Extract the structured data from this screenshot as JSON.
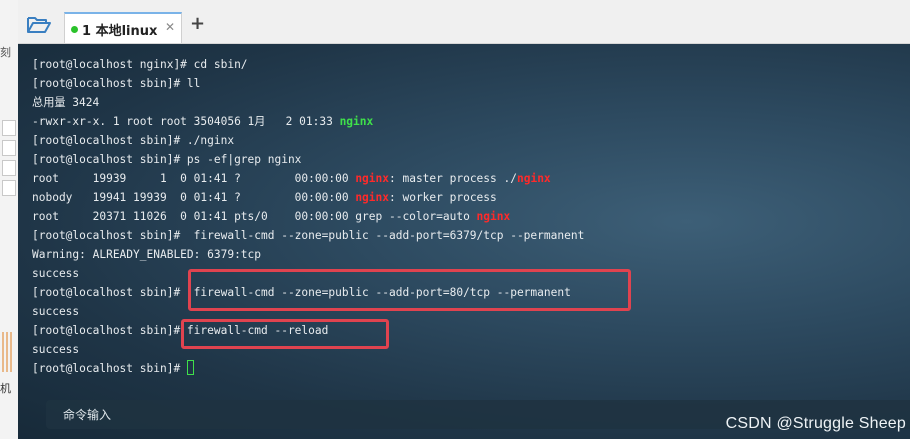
{
  "left_partial": {
    "top_char": "刻",
    "bottom_char": "机"
  },
  "toolbar": {
    "folder_icon": "folder-open-icon"
  },
  "tabs": [
    {
      "label": "1 本地linux",
      "status_color": "#2bc22b",
      "close": "✕"
    }
  ],
  "add_tab_label": "+",
  "terminal": {
    "lines": [
      [
        {
          "t": "[root@localhost nginx]# cd sbin/"
        }
      ],
      [
        {
          "t": "[root@localhost sbin]# ll"
        }
      ],
      [
        {
          "t": "总用量 3424"
        }
      ],
      [
        {
          "t": "-rwxr-xr-x. 1 root root 3504056 1月   2 01:33 "
        },
        {
          "t": "nginx",
          "c": "green"
        }
      ],
      [
        {
          "t": "[root@localhost sbin]# ./nginx"
        }
      ],
      [
        {
          "t": "[root@localhost sbin]# ps -ef|grep nginx"
        }
      ],
      [
        {
          "t": "root     19939     1  0 01:41 ?        00:00:00 "
        },
        {
          "t": "nginx",
          "c": "red"
        },
        {
          "t": ": master process ./"
        },
        {
          "t": "nginx",
          "c": "red"
        }
      ],
      [
        {
          "t": "nobody   19941 19939  0 01:41 ?        00:00:00 "
        },
        {
          "t": "nginx",
          "c": "red"
        },
        {
          "t": ": worker process"
        }
      ],
      [
        {
          "t": "root     20371 11026  0 01:41 pts/0    00:00:00 grep --color=auto "
        },
        {
          "t": "nginx",
          "c": "red"
        }
      ],
      [
        {
          "t": "[root@localhost sbin]#  firewall-cmd --zone=public --add-port=6379/tcp --permanent"
        }
      ],
      [
        {
          "t": "Warning: ALREADY_ENABLED: 6379:tcp"
        }
      ],
      [
        {
          "t": "success"
        }
      ],
      [
        {
          "t": "[root@localhost sbin]#  firewall-cmd --zone=public --add-port=80/tcp --permanent"
        }
      ],
      [
        {
          "t": "success"
        }
      ],
      [
        {
          "t": "[root@localhost sbin]# firewall-cmd --reload"
        }
      ],
      [
        {
          "t": "success"
        }
      ],
      [
        {
          "t": "[root@localhost sbin]# "
        },
        {
          "cursor": true
        }
      ]
    ],
    "command_input_label": "命令输入"
  },
  "watermark": "CSDN @Struggle Sheep",
  "colors": {
    "green": "#3fe04a",
    "red": "#ff2a2a",
    "annotation": "#e0434f"
  }
}
